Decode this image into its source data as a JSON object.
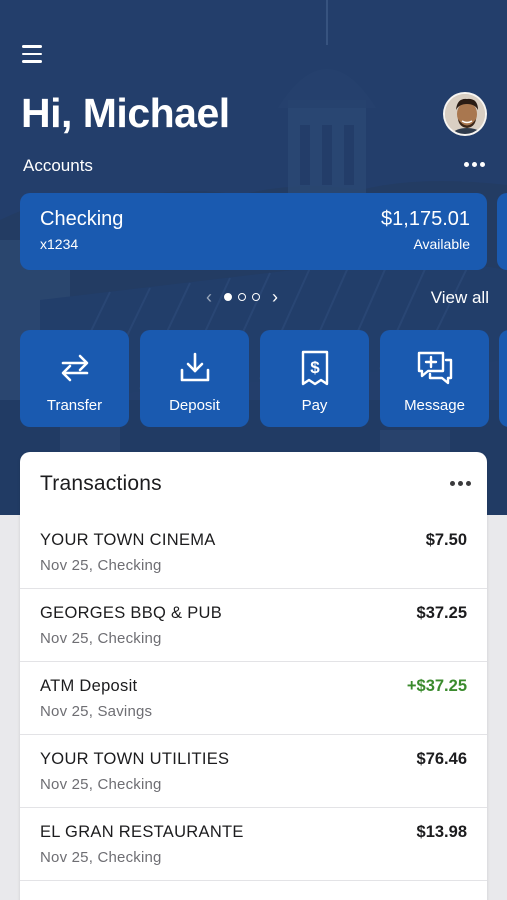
{
  "header": {
    "greeting": "Hi, Michael",
    "menu_icon": "hamburger-menu-icon",
    "avatar_icon": "user-avatar"
  },
  "accounts": {
    "label": "Accounts",
    "more_icon": "more-horizontal-icon",
    "card": {
      "name": "Checking",
      "number": "x1234",
      "balance": "$1,175.01",
      "balance_label": "Available"
    },
    "pager": {
      "pages": 3,
      "current": 1
    },
    "view_all": "View all"
  },
  "actions": [
    {
      "label": "Transfer",
      "icon": "transfer-arrows-icon"
    },
    {
      "label": "Deposit",
      "icon": "download-tray-icon"
    },
    {
      "label": "Pay",
      "icon": "receipt-dollar-icon"
    },
    {
      "label": "Message",
      "icon": "chat-plus-icon"
    }
  ],
  "transactions": {
    "title": "Transactions",
    "items": [
      {
        "name": "YOUR TOWN CINEMA",
        "meta": "Nov 25, Checking",
        "amount": "$7.50",
        "type": "debit"
      },
      {
        "name": "GEORGES BBQ & PUB",
        "meta": "Nov 25, Checking",
        "amount": "$37.25",
        "type": "debit"
      },
      {
        "name": "ATM Deposit",
        "meta": "Nov 25, Savings",
        "amount": "+$37.25",
        "type": "credit"
      },
      {
        "name": "YOUR TOWN UTILITIES",
        "meta": "Nov 25, Checking",
        "amount": "$76.46",
        "type": "debit"
      },
      {
        "name": "EL GRAN RESTAURANTE",
        "meta": "Nov 25, Checking",
        "amount": "$13.98",
        "type": "debit"
      }
    ]
  },
  "colors": {
    "card_blue": "#1a5ab0",
    "credit_green": "#3b8b2e",
    "hero_navy": "#223d66"
  }
}
